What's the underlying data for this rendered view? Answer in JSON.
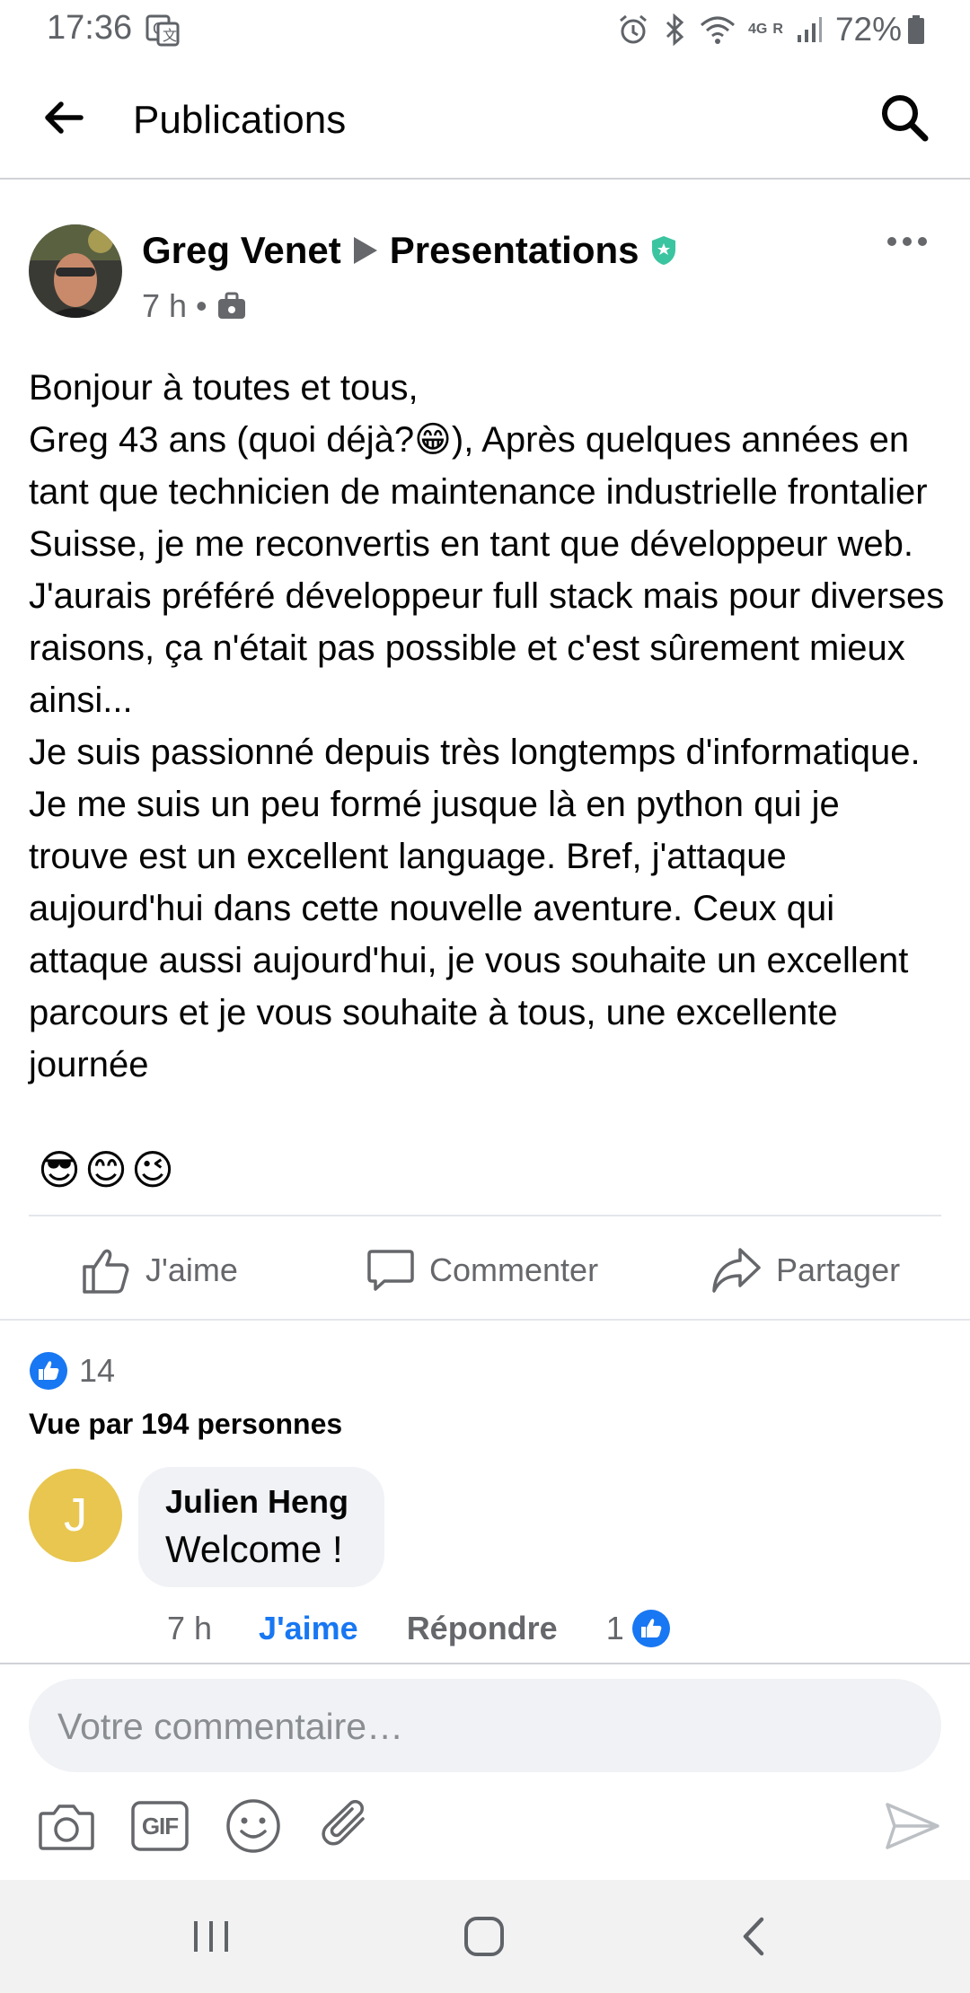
{
  "status": {
    "time": "17:36",
    "network": "4G",
    "roaming": "R",
    "battery": "72%"
  },
  "header": {
    "title": "Publications"
  },
  "post": {
    "author": "Greg Venet",
    "group": "Presentations",
    "time": "7 h",
    "separator": "•",
    "body": "Bonjour à toutes et tous,\nGreg 43 ans (quoi déjà?😁), Après quelques années en tant que technicien de maintenance industrielle frontalier Suisse, je me reconvertis en tant que développeur web. J'aurais préféré développeur full stack mais pour diverses raisons, ça n'était pas possible et c'est sûrement mieux ainsi...\nJe suis passionné depuis très longtemps d'informatique. Je me suis un peu formé jusque là en python qui je trouve est un excellent language. Bref, j'attaque aujourd'hui dans cette nouvelle aventure. Ceux qui attaque aussi aujourd'hui, je vous souhaite un excellent parcours et je vous souhaite à tous, une excellente journée",
    "emojis": [
      "😎",
      "😊",
      "😉"
    ]
  },
  "actions": {
    "like": "J'aime",
    "comment": "Commenter",
    "share": "Partager"
  },
  "stats": {
    "likes": "14",
    "seen_by": "Vue par 194 personnes"
  },
  "comment": {
    "initial": "J",
    "author": "Julien Heng",
    "text": "Welcome !",
    "time": "7 h",
    "like": "J'aime",
    "reply": "Répondre",
    "reactions": "1"
  },
  "composer": {
    "placeholder": "Votre commentaire…",
    "gif_label": "GIF"
  },
  "colors": {
    "brand_blue": "#1877f2",
    "avatar_yellow": "#e8c64f",
    "text_secondary": "#65676b"
  }
}
